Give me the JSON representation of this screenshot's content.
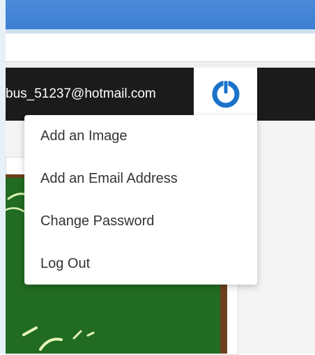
{
  "account": {
    "email": "bus_51237@hotmail.com",
    "power_button_icon": "power-icon"
  },
  "dropdown_menu": {
    "items": [
      {
        "label": "Add an Image"
      },
      {
        "label": "Add an Email Address"
      },
      {
        "label": "Change Password"
      },
      {
        "label": "Log Out"
      }
    ]
  },
  "colors": {
    "header_blue": "#3f7fd3",
    "account_bar": "#1b1b1b",
    "power_icon": "#1a73c9",
    "chalkboard": "#226b23"
  }
}
